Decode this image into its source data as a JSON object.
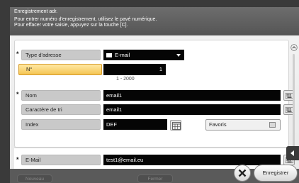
{
  "header": {
    "title": "Enregistrement adr.",
    "line1": "Pour entrer numéro d'enregistrement, utilisez le pavé numérique.",
    "line2": "Pour effacer votre saisie, appuyez sur la touche [C]."
  },
  "form": {
    "address_type": {
      "label": "Type d'adresse",
      "value": "E-mail",
      "icon": "mail-icon"
    },
    "number": {
      "label": "N°",
      "value": "1",
      "range": "1 - 2000"
    },
    "name": {
      "label": "Nom",
      "value": "email1"
    },
    "sort_char": {
      "label": "Caractère de tri",
      "value": "email1"
    },
    "index": {
      "label": "Index",
      "value": "DEF"
    },
    "favorites": {
      "label": "Favoris"
    },
    "email": {
      "label": "E-Mail",
      "value": "test1@email.eu"
    },
    "required_marker": "*"
  },
  "footer": {
    "new_label": "Nouveau",
    "middle_label": "Fermer",
    "save_label": "Enregistrer"
  },
  "colors": {
    "header_bg": "#5f5f5f",
    "field_bg": "#050505",
    "selected_label_bg": "#f4c452"
  }
}
